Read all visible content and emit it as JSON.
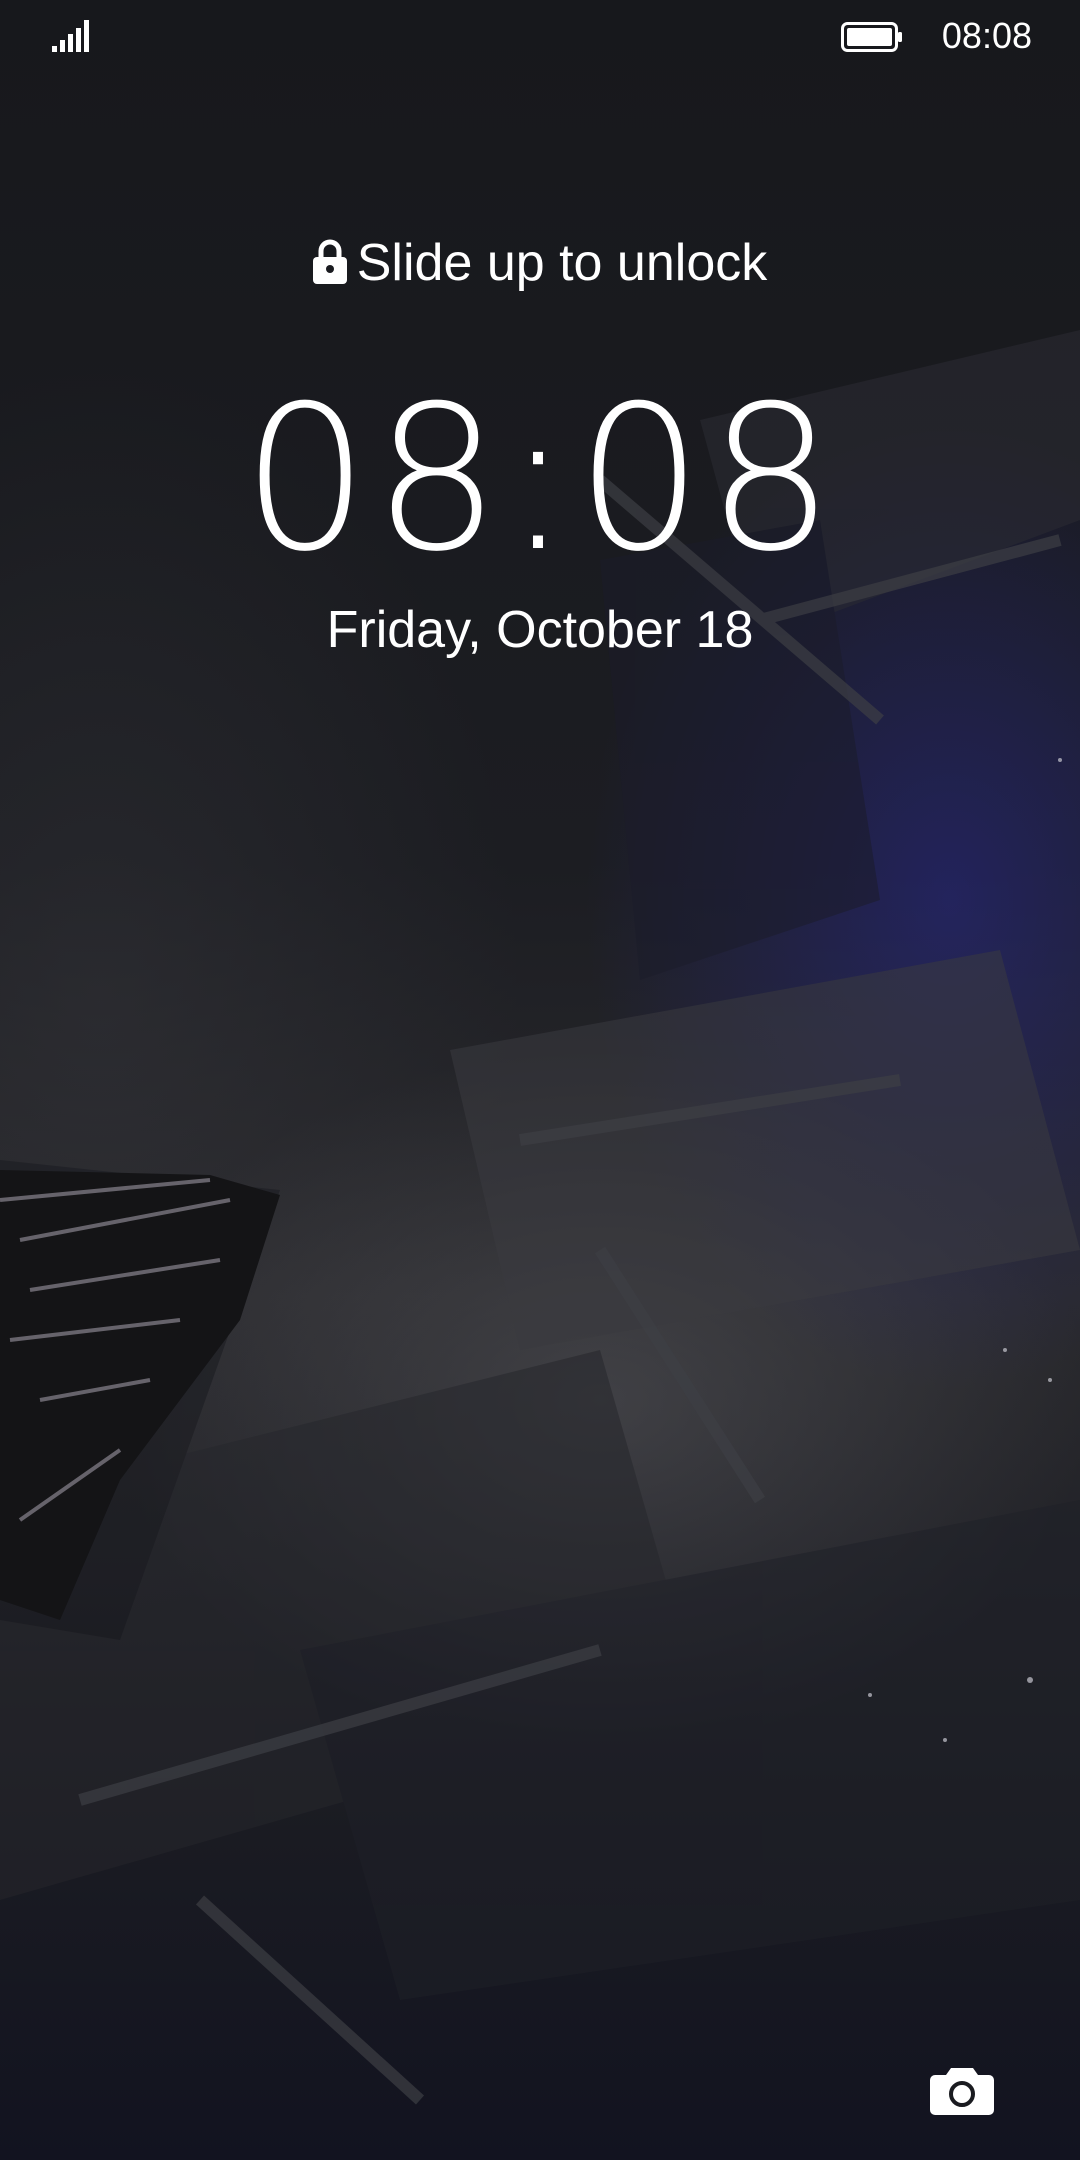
{
  "status_bar": {
    "time": "08:08",
    "signal_icon": "signal-bars-icon",
    "battery_icon": "battery-full-icon"
  },
  "lockscreen": {
    "unlock_hint": "Slide up to unlock",
    "lock_icon": "lock-icon",
    "clock": "08:08",
    "date": "Friday, October 18"
  },
  "shortcuts": {
    "camera_icon": "camera-icon"
  },
  "colors": {
    "text": "#ffffff",
    "background": "#17181c",
    "accent_glow": "#28288c"
  }
}
